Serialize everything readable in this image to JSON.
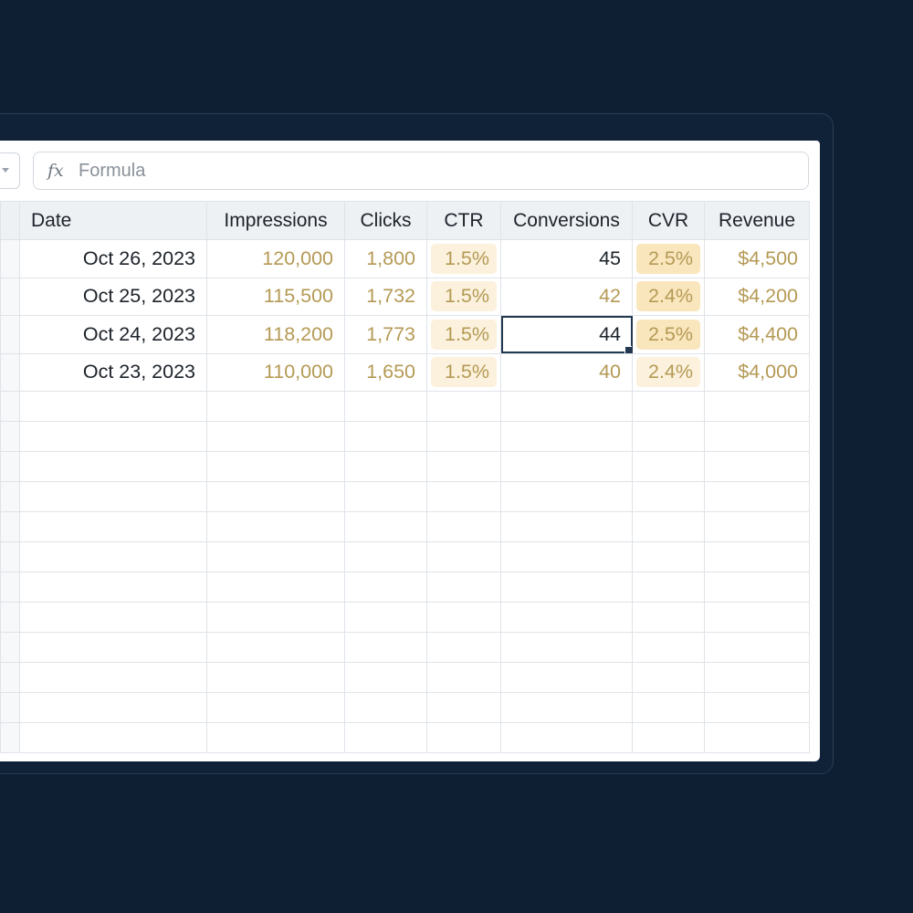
{
  "formula_bar": {
    "icon": "fx",
    "placeholder": "Formula"
  },
  "columns": [
    "Date",
    "Impressions",
    "Clicks",
    "CTR",
    "Conversions",
    "CVR",
    "Revenue"
  ],
  "rows": [
    {
      "date": "Oct 26, 2023",
      "impressions": "120,000",
      "clicks": "1,800",
      "ctr": "1.5%",
      "conversions": "45",
      "cvr": "2.5%",
      "revenue": "$4,500"
    },
    {
      "date": "Oct 25, 2023",
      "impressions": "115,500",
      "clicks": "1,732",
      "ctr": "1.5%",
      "conversions": "42",
      "cvr": "2.4%",
      "revenue": "$4,200"
    },
    {
      "date": "Oct 24, 2023",
      "impressions": "118,200",
      "clicks": "1,773",
      "ctr": "1.5%",
      "conversions": "44",
      "cvr": "2.5%",
      "revenue": "$4,400"
    },
    {
      "date": "Oct 23, 2023",
      "impressions": "110,000",
      "clicks": "1,650",
      "ctr": "1.5%",
      "conversions": "40",
      "cvr": "2.4%",
      "revenue": "$4,000"
    }
  ],
  "selected_cell": {
    "row": 2,
    "column": "Conversions"
  },
  "colors": {
    "background": "#0e1f33",
    "header": "#eef1f4",
    "accent_text": "#b59a55",
    "highlight": "#f9e6bd",
    "selection": "#22384f"
  }
}
